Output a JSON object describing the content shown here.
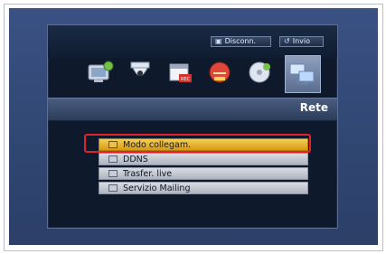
{
  "top_buttons": {
    "disconnect_label": "Disconn.",
    "send_label": "Invio"
  },
  "icons": [
    {
      "name": "display-settings-icon"
    },
    {
      "name": "camera-icon"
    },
    {
      "name": "record-calendar-icon"
    },
    {
      "name": "event-alarm-icon"
    },
    {
      "name": "backup-disk-icon"
    },
    {
      "name": "network-icon",
      "selected": true
    }
  ],
  "section_title": "Rete",
  "menu": {
    "items": [
      {
        "label": "Modo collegam.",
        "selected": true
      },
      {
        "label": "DDNS"
      },
      {
        "label": "Trasfer. live"
      },
      {
        "label": "Servizio Mailing"
      }
    ]
  },
  "colors": {
    "background": "#324877",
    "selected_item": "#e3aa22",
    "highlight_box": "#e0222c"
  }
}
